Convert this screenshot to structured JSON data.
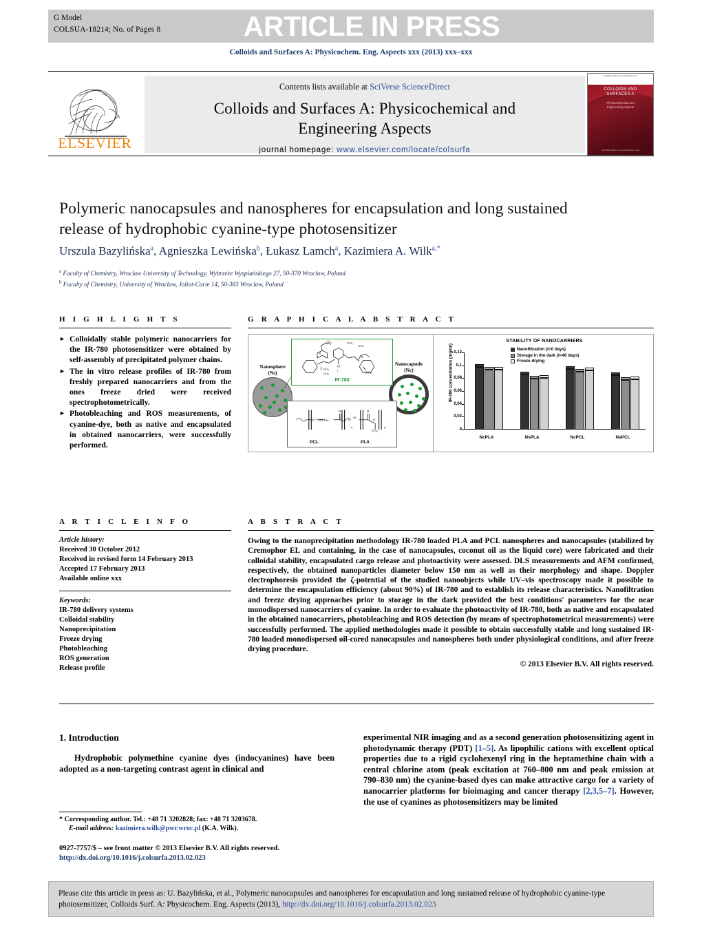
{
  "banner": {
    "g_model": "G Model",
    "article_id": "COLSUA-18214;   No. of Pages 8",
    "title": "ARTICLE IN PRESS",
    "journal_ref": "Colloids and Surfaces A: Physicochem. Eng. Aspects xxx (2013) xxx–xxx",
    "bg_color": "#c9c9c9"
  },
  "masthead": {
    "contents_prefix": "Contents lists available at ",
    "contents_link": "SciVerse ScienceDirect",
    "journal_name_line1": "Colloids and Surfaces A: Physicochemical and",
    "journal_name_line2": "Engineering Aspects",
    "homepage_prefix": "journal homepage: ",
    "homepage_link": "www.elsevier.com/locate/colsurfa",
    "publisher": "ELSEVIER",
    "cover": {
      "top_note": "Available online at www.sciencedirect.com",
      "title_l1": "COLLOIDS AND",
      "title_l2": "SURFACES A",
      "sub_l1": "Physicochemical and",
      "sub_l2": "Engineering Aspects",
      "bottom": "Available online at www.sciencedirect.com"
    },
    "link_color": "#2b4f9e"
  },
  "article": {
    "title": "Polymeric nanocapsules and nanospheres for encapsulation and long sustained release of hydrophobic cyanine-type photosensitizer",
    "authors_html": "Urszula Bazylińska<sup>a</sup>, Agnieszka Lewińska<sup>b</sup>, Łukasz Lamch<sup>a</sup>, Kazimiera A. Wilk<sup>a,*</sup>",
    "affiliation_a": "Faculty of Chemistry, Wroclaw University of Technology, Wybrzeże Wyspiańskiego 27, 50-370 Wroclaw, Poland",
    "affiliation_b": "Faculty of Chemistry, University of Wroclaw, Joliot-Curie 14, 50-383 Wroclaw, Poland"
  },
  "highlights": {
    "heading": "H I G H L I G H T S",
    "bullet_glyph": "►",
    "items": [
      "Colloidally stable polymeric nanocarriers for the IR-780 photosensitizer were obtained by self-assembly of precipitated polymer chains.",
      "The in vitro release profiles of IR-780 from freshly prepared nanocarriers and from the ones freeze dried were received spectrophotometrically.",
      "Photobleaching and ROS measurements, of cyanine-dye, both as native and encapsulated in obtained nanocarriers, were successfully performed."
    ]
  },
  "graphical_abstract": {
    "heading": "G R A P H I C A L   A B S T R A C T",
    "nanosphere_label_l1": "Nanosphere",
    "nanosphere_label_l2": "(Ns)",
    "nanocapsule_label_l1": "Nanocapsule",
    "nanocapsule_label_l2": "(Nc)",
    "molecule_name": "IR-780",
    "polymer_left": "PCL",
    "polymer_or": "or",
    "polymer_right": "PLA"
  },
  "chart_data": {
    "type": "bar",
    "title": "STABILITY OF NANOCARRIERS",
    "xlabel": "",
    "ylabel": "IR-780 concentration (mg/ml)",
    "categories": [
      "NcPLA",
      "NsPLA",
      "NcPCL",
      "NsPCL"
    ],
    "ylim": [
      0,
      0.12
    ],
    "yticks": [
      "0",
      "0,02",
      "0,04",
      "0,06",
      "0,08",
      "0,1",
      "0,12"
    ],
    "ytick_values": [
      0,
      0.02,
      0.04,
      0.06,
      0.08,
      0.1,
      0.12
    ],
    "grid": false,
    "legend_position": "top-center",
    "series": [
      {
        "name": "Nanofiltration (t=0 days)",
        "color": "#333333",
        "values": [
          0.097,
          0.086,
          0.094,
          0.085
        ]
      },
      {
        "name": "Storage in the dark (t=46 days)",
        "color": "#8d8d8d",
        "values": [
          0.093,
          0.079,
          0.09,
          0.077
        ]
      },
      {
        "name": "Freeze drying",
        "color": "#d2d2d2",
        "values": [
          0.093,
          0.08,
          0.092,
          0.078
        ]
      }
    ]
  },
  "article_info": {
    "heading": "A R T I C L E   I N F O",
    "history_label": "Article history:",
    "history": [
      "Received 30 October 2012",
      "Received in revised form 14 February 2013",
      "Accepted 17 February 2013",
      "Available online xxx"
    ],
    "keywords_label": "Keywords:",
    "keywords": [
      "IR-780 delivery systems",
      "Colloidal stability",
      "Nanoprecipitation",
      "Freeze drying",
      "Photobleaching",
      "ROS generation",
      "Release profile"
    ]
  },
  "abstract": {
    "heading": "A B S T R A C T",
    "text": "Owing to the nanoprecipitation methodology IR-780 loaded PLA and PCL nanospheres and nanocapsules (stabilized by Cremophor EL and containing, in the case of nanocapsules, coconut oil as the liquid core) were fabricated and their colloidal stability, encapsulated cargo release and photoactivity were assessed. DLS measurements and AFM confirmed, respectively, the obtained nanoparticles diameter below 150 nm as well as their morphology and shape. Doppler electrophoresis provided the ζ-potential of the studied nanoobjects while UV–vis spectroscopy made it possible to determine the encapsulation efficiency (about 90%) of IR-780 and to establish its release characteristics. Nanofiltration and freeze drying approaches prior to storage in the dark provided the best conditions' parameters for the near monodispersed nanocarriers of cyanine. In order to evaluate the photoactivity of IR-780, both as native and encapsulated in the obtained nanocarriers, photobleaching and ROS detection (by means of spectrophotometrical measurements) were successfully performed. The applied methodologies made it possible to obtain successfully stable and long sustained IR-780 loaded monodispersed oil-cored nanocapsules and nanospheres both under physiological conditions, and after freeze drying procedure.",
    "copyright": "© 2013 Elsevier B.V. All rights reserved."
  },
  "body": {
    "section_number_title": "1.  Introduction",
    "left_paragraph": "Hydrophobic polymethine cyanine dyes (indocyanines) have been adopted as a non-targeting contrast agent in clinical and",
    "right_paragraph_1": "experimental NIR imaging and as a second generation photosensitizing agent in photodynamic therapy (PDT) ",
    "right_ref_1": "[1–5]",
    "right_paragraph_2": ". As lipophilic cations with excellent optical properties due to a rigid cyclohexenyl ring in the heptamethine chain with a central chlorine atom (peak excitation at 760–800 nm and peak emission at 790–830 nm) the cyanine-based dyes can make attractive cargo for a variety of nanocarrier platforms for bioimaging and cancer therapy ",
    "right_ref_2": "[2,3,5–7]",
    "right_paragraph_3": ". However, the use of cyanines as photosensitizers may be limited"
  },
  "footnote": {
    "corresponding": "* Corresponding author. Tel.: +48 71 3202828; fax: +48 71 3203678.",
    "email_label": "E-mail address:",
    "email": "kazimiera.wilk@pwr.wroc.pl",
    "email_owner": "(K.A. Wilk).",
    "front_matter": "0927-7757/$ – see front matter © 2013 Elsevier B.V. All rights reserved.",
    "doi": "http://dx.doi.org/10.1016/j.colsurfa.2013.02.023"
  },
  "cite_box": {
    "text_part1": "Please cite this article in press as: U. Bazylińska, et al., Polymeric nanocapsules and nanospheres for encapsulation and long sustained release of hydrophobic cyanine-type photosensitizer, Colloids Surf. A: Physicochem. Eng. Aspects (2013), ",
    "link": "http://dx.doi.org/10.1016/j.colsurfa.2013.02.023"
  }
}
